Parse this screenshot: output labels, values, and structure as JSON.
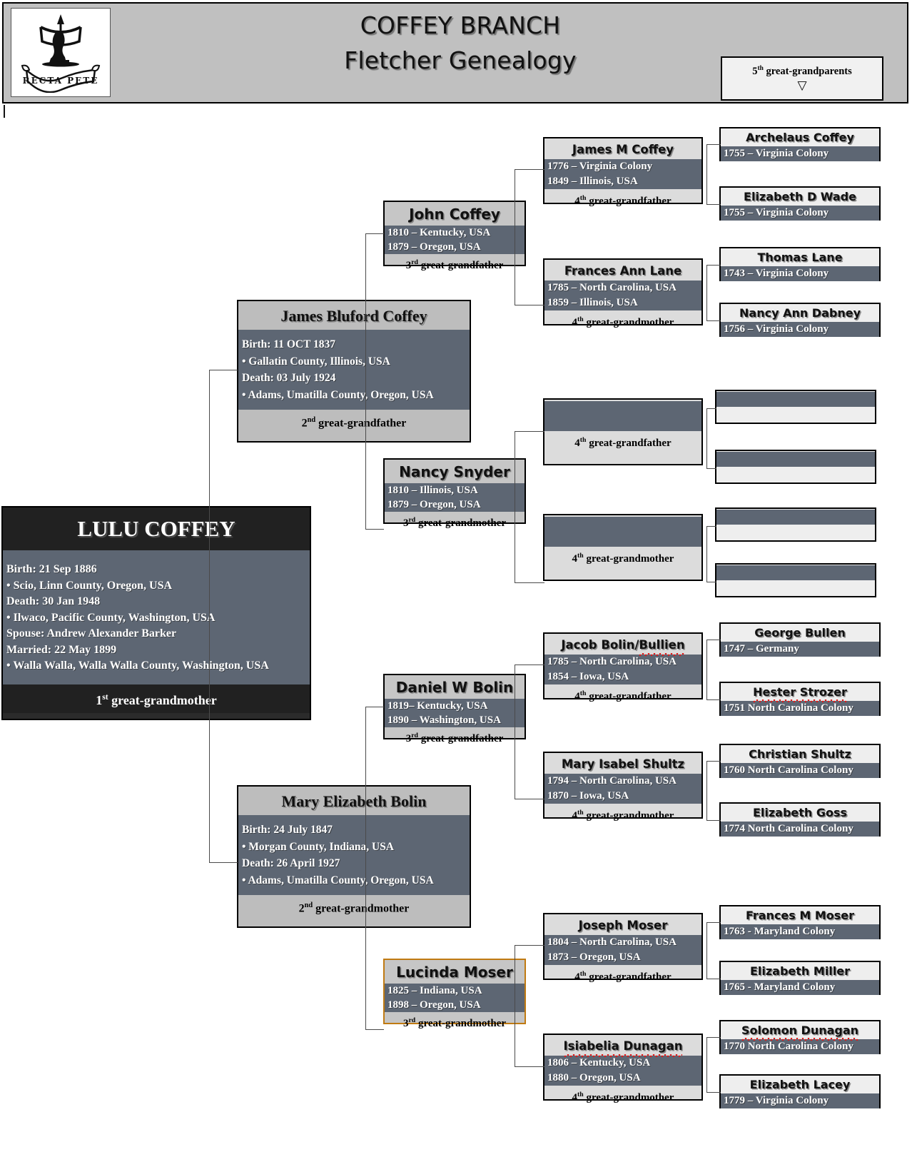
{
  "header": {
    "title_line1": "COFFEY BRANCH",
    "title_line2": "Fletcher Genealogy",
    "logo_motto": "RECTA PETE",
    "logo_alt": "archer-crest-logo",
    "legend": {
      "label_prefix": "5",
      "label_sup": "th",
      "label_text": " great-grandparents",
      "arrow": "▽"
    }
  },
  "colors": {
    "header_bg": "#c0c0c0",
    "dates_band": "#5d6673",
    "level1_bg": "#212121",
    "level2_bg": "#bdbdbd",
    "level3_bg": "#c6c6c6",
    "level4_bg": "#dcdcdc",
    "level5_bg": "#eeeeee",
    "highlight_border": "#c07a12",
    "spellcheck_underline": "#e01b1b"
  },
  "subject": {
    "name": "LULU COFFEY",
    "lines": [
      "Birth:  21 Sep 1886",
      "• Scio, Linn County, Oregon, USA",
      "Death:  30 Jan 1948",
      "• Ilwaco, Pacific County, Washington, USA",
      "Spouse:  Andrew Alexander Barker",
      "Married:  22 May 1899",
      "• Walla Walla, Walla Walla County, Washington, USA"
    ],
    "relation_prefix": "1",
    "relation_sup": "st",
    "relation_text": " great-grandmother"
  },
  "level2": [
    {
      "id": "james-bluford-coffey",
      "name": "James Bluford Coffey",
      "lines": [
        "Birth:  11 OCT 1837",
        "• Gallatin County, Illinois, USA",
        "Death:  03 July 1924",
        "• Adams, Umatilla County, Oregon, USA"
      ],
      "relation_prefix": "2",
      "relation_sup": "nd",
      "relation_text": " great-grandfather"
    },
    {
      "id": "mary-elizabeth-bolin",
      "name": "Mary Elizabeth Bolin",
      "lines": [
        "Birth:  24 July 1847",
        "• Morgan County, Indiana, USA",
        "Death:  26 April 1927",
        "• Adams, Umatilla County, Oregon, USA"
      ],
      "relation_prefix": "2",
      "relation_sup": "nd",
      "relation_text": " great-grandmother"
    }
  ],
  "level3": [
    {
      "id": "john-coffey",
      "name": "John Coffey",
      "birth": "1810 – Kentucky, USA",
      "death": "1879 – Oregon, USA",
      "relation_prefix": "3",
      "relation_sup": "rd",
      "relation_text": " great-grandfather"
    },
    {
      "id": "nancy-snyder",
      "name": "Nancy Snyder",
      "birth": "1810 – Illinois, USA",
      "death": "1879 – Oregon, USA",
      "relation_prefix": "3",
      "relation_sup": "rd",
      "relation_text": " great-grandmother"
    },
    {
      "id": "daniel-w-bolin",
      "name": "Daniel W Bolin",
      "birth": "1819– Kentucky, USA",
      "death": "1890 – Washington, USA",
      "relation_prefix": "3",
      "relation_sup": "rd",
      "relation_text": " great-grandfather"
    },
    {
      "id": "lucinda-moser",
      "name": "Lucinda Moser",
      "birth": "1825 – Indiana, USA",
      "death": "1898 – Oregon, USA",
      "relation_prefix": "3",
      "relation_sup": "rd",
      "relation_text": " great-grandmother",
      "highlighted": true
    }
  ],
  "level4": [
    {
      "id": "james-m-coffey",
      "name": "James M Coffey",
      "birth": "1776 – Virginia Colony",
      "death": "1849 – Illinois, USA",
      "relation_prefix": "4",
      "relation_sup": "th",
      "relation_text": " great-grandfather"
    },
    {
      "id": "frances-ann-lane",
      "name": "Frances Ann Lane",
      "birth": "1785 – North Carolina, USA",
      "death": "1859 – Illinois, USA",
      "relation_prefix": "4",
      "relation_sup": "th",
      "relation_text": " great-grandmother"
    },
    {
      "id": "unknown-4th-great-grandfather-snyder",
      "name": "",
      "birth": "",
      "death": "",
      "relation_prefix": "4",
      "relation_sup": "th",
      "relation_text": " great-grandfather",
      "empty": true
    },
    {
      "id": "unknown-4th-great-grandmother-snyder",
      "name": "",
      "birth": "",
      "death": "",
      "relation_prefix": "4",
      "relation_sup": "th",
      "relation_text": " great-grandmother",
      "empty": true
    },
    {
      "id": "jacob-bolin-bullien",
      "name": "Jacob Bolin/Bullien",
      "name_plain": "Jacob Bolin/",
      "name_misspelled": "Bullien",
      "birth": "1785 – North Carolina, USA",
      "death": "1854 – Iowa, USA",
      "relation_prefix": "4",
      "relation_sup": "th",
      "relation_text": " great-grandfather"
    },
    {
      "id": "mary-isabel-shultz",
      "name": "Mary Isabel Shultz",
      "birth": "1794 – North Carolina, USA",
      "death": "1870 – Iowa, USA",
      "relation_prefix": "4",
      "relation_sup": "th",
      "relation_text": " great-grandmother"
    },
    {
      "id": "joseph-moser",
      "name": "Joseph Moser",
      "birth": "1804 – North Carolina, USA",
      "death": "1873 – Oregon, USA",
      "relation_prefix": "4",
      "relation_sup": "th",
      "relation_text": " great-grandfather"
    },
    {
      "id": "isiabelia-dunagan",
      "name": "Isiabelia Dunagan",
      "name_misspelled": "Isiabelia Dunagan",
      "birth": "1806 – Kentucky, USA",
      "death": "1880 – Oregon, USA",
      "relation_prefix": "4",
      "relation_sup": "th",
      "relation_text": " great-grandmother"
    }
  ],
  "level5": [
    {
      "id": "archelaus-coffey",
      "name": "Archelaus Coffey",
      "birth": "1755 – Virginia Colony"
    },
    {
      "id": "elizabeth-d-wade",
      "name": "Elizabeth D Wade",
      "birth": "1755 – Virginia Colony"
    },
    {
      "id": "thomas-lane",
      "name": "Thomas Lane",
      "birth": "1743 – Virginia Colony"
    },
    {
      "id": "nancy-ann-dabney",
      "name": "Nancy Ann Dabney",
      "birth": "1756 – Virginia Colony"
    },
    {
      "id": "unknown-5th-1",
      "name": "",
      "birth": "",
      "empty": true
    },
    {
      "id": "unknown-5th-2",
      "name": "",
      "birth": "",
      "empty": true
    },
    {
      "id": "unknown-5th-3",
      "name": "",
      "birth": "",
      "empty": true
    },
    {
      "id": "unknown-5th-4",
      "name": "",
      "birth": "",
      "empty": true
    },
    {
      "id": "george-bullen",
      "name": "George Bullen",
      "birth": "1747 – Germany"
    },
    {
      "id": "hester-strozer",
      "name": "Hester Strozer",
      "name_misspelled": "Strozer",
      "birth": "1751 North Carolina Colony"
    },
    {
      "id": "christian-shultz",
      "name": "Christian Shultz",
      "birth": "1760 North Carolina Colony"
    },
    {
      "id": "elizabeth-goss",
      "name": "Elizabeth Goss",
      "birth": "1774 North Carolina Colony"
    },
    {
      "id": "frances-m-moser",
      "name": "Frances M Moser",
      "birth": "1763 -  Maryland Colony"
    },
    {
      "id": "elizabeth-miller",
      "name": "Elizabeth Miller",
      "birth": "1765 -  Maryland Colony"
    },
    {
      "id": "solomon-dunagan",
      "name": "Solomon Dunagan",
      "name_misspelled": "Dunagan",
      "birth": "1770 North Carolina Colony"
    },
    {
      "id": "elizabeth-lacey",
      "name": "Elizabeth Lacey",
      "birth": "1779 – Virginia Colony"
    }
  ]
}
